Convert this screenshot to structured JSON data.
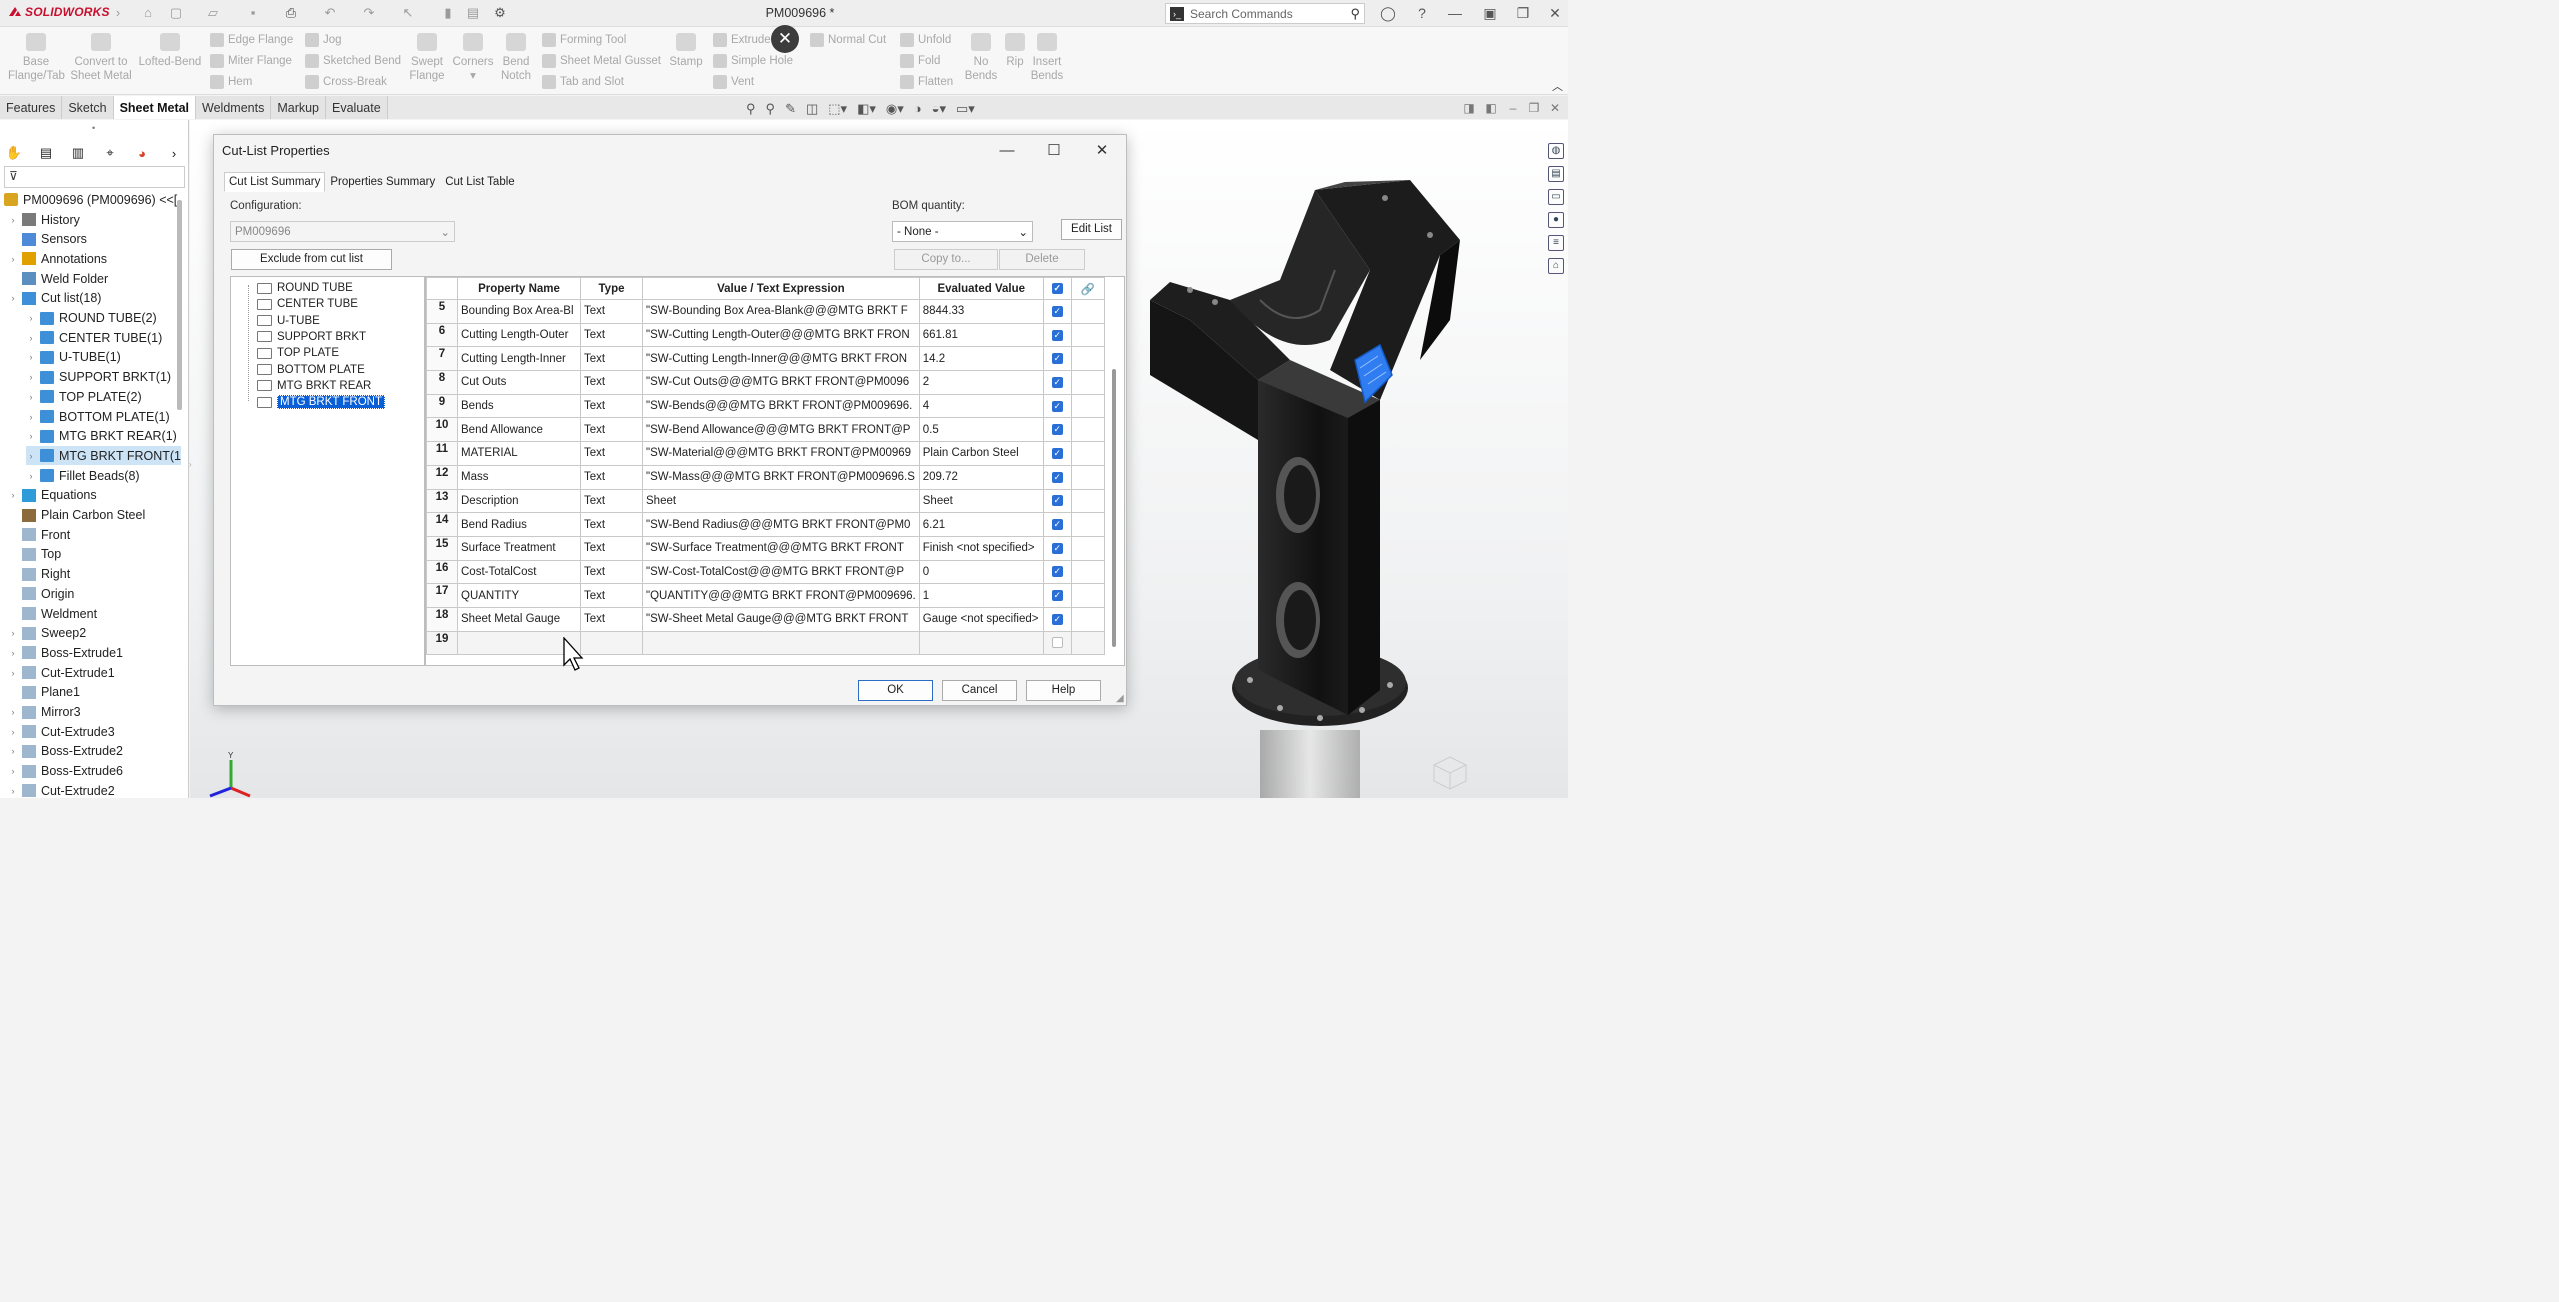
{
  "app": {
    "logo": "SOLIDWORKS",
    "doc_title": "PM009696 *",
    "search_placeholder": "Search Commands"
  },
  "commands": {
    "base_flange": [
      "Base",
      "Flange/Tab"
    ],
    "convert": [
      "Convert to",
      "Sheet Metal"
    ],
    "lofted_bend": "Lofted-Bend",
    "edge_flange": "Edge Flange",
    "jog": "Jog",
    "miter_flange": "Miter Flange",
    "sketched_bend": "Sketched Bend",
    "hem": "Hem",
    "cross_break": "Cross-Break",
    "swept_flange": [
      "Swept",
      "Flange"
    ],
    "corners": "Corners",
    "bend_notch": [
      "Bend",
      "Notch"
    ],
    "forming_tool": "Forming Tool",
    "sheet_metal_gusset": "Sheet Metal Gusset",
    "tab_and_slot": "Tab and Slot",
    "stamp": "Stamp",
    "extruded_cut": "Extrude",
    "simple_hole": "Simple Hole",
    "vent": "Vent",
    "normal_cut": "Normal Cut",
    "unfold": "Unfold",
    "fold": "Fold",
    "flatten": "Flatten",
    "no_bends": [
      "No",
      "Bends"
    ],
    "rip": "Rip",
    "insert_bends": [
      "Insert",
      "Bends"
    ]
  },
  "tabs": [
    "Features",
    "Sketch",
    "Sheet Metal",
    "Weldments",
    "Markup",
    "Evaluate"
  ],
  "active_tab": "Sheet Metal",
  "tree": {
    "root": "PM009696 (PM009696) <<[",
    "items": [
      {
        "label": "History",
        "indent": 0,
        "twisty": true
      },
      {
        "label": "Sensors",
        "indent": 0,
        "twisty": false
      },
      {
        "label": "Annotations",
        "indent": 0,
        "twisty": true
      },
      {
        "label": "Weld Folder",
        "indent": 0,
        "twisty": false
      },
      {
        "label": "Cut list(18)",
        "indent": 0,
        "twisty": true
      },
      {
        "label": "ROUND TUBE(2)",
        "indent": 1,
        "twisty": true
      },
      {
        "label": "CENTER TUBE(1)",
        "indent": 1,
        "twisty": true
      },
      {
        "label": "U-TUBE(1)",
        "indent": 1,
        "twisty": true
      },
      {
        "label": "SUPPORT BRKT(1)",
        "indent": 1,
        "twisty": true
      },
      {
        "label": "TOP PLATE(2)",
        "indent": 1,
        "twisty": true
      },
      {
        "label": "BOTTOM PLATE(1)",
        "indent": 1,
        "twisty": true
      },
      {
        "label": "MTG BRKT REAR(1)",
        "indent": 1,
        "twisty": true
      },
      {
        "label": "MTG BRKT FRONT(1",
        "indent": 1,
        "twisty": true,
        "selected": true
      },
      {
        "label": "Fillet Beads(8)",
        "indent": 1,
        "twisty": true
      },
      {
        "label": "Equations",
        "indent": 0,
        "twisty": true
      },
      {
        "label": "Plain Carbon Steel",
        "indent": 0,
        "twisty": false
      },
      {
        "label": "Front",
        "indent": 0,
        "twisty": false
      },
      {
        "label": "Top",
        "indent": 0,
        "twisty": false
      },
      {
        "label": "Right",
        "indent": 0,
        "twisty": false
      },
      {
        "label": "Origin",
        "indent": 0,
        "twisty": false
      },
      {
        "label": "Weldment",
        "indent": 0,
        "twisty": false
      },
      {
        "label": "Sweep2",
        "indent": 0,
        "twisty": true
      },
      {
        "label": "Boss-Extrude1",
        "indent": 0,
        "twisty": true
      },
      {
        "label": "Cut-Extrude1",
        "indent": 0,
        "twisty": true
      },
      {
        "label": "Plane1",
        "indent": 0,
        "twisty": false
      },
      {
        "label": "Mirror3",
        "indent": 0,
        "twisty": true
      },
      {
        "label": "Cut-Extrude3",
        "indent": 0,
        "twisty": true
      },
      {
        "label": "Boss-Extrude2",
        "indent": 0,
        "twisty": true
      },
      {
        "label": "Boss-Extrude6",
        "indent": 0,
        "twisty": true
      },
      {
        "label": "Cut-Extrude2",
        "indent": 0,
        "twisty": true
      }
    ]
  },
  "dialog": {
    "title": "Cut-List Properties",
    "tabs": [
      "Cut List Summary",
      "Properties Summary",
      "Cut List Table"
    ],
    "configuration_label": "Configuration:",
    "configuration_value": "PM009696",
    "bom_label": "BOM quantity:",
    "bom_value": "- None -",
    "edit_list": "Edit List",
    "exclude": "Exclude from cut list",
    "copy_to": "Copy to...",
    "delete": "Delete",
    "cutlist_items": [
      "ROUND TUBE",
      "CENTER TUBE",
      "U-TUBE",
      "SUPPORT BRKT",
      "TOP PLATE",
      "BOTTOM PLATE",
      "MTG BRKT REAR",
      "MTG BRKT FRONT"
    ],
    "selected_item": "MTG BRKT FRONT",
    "columns": [
      "Property Name",
      "Type",
      "Value / Text Expression",
      "Evaluated Value"
    ],
    "rows": [
      {
        "n": "5",
        "name": "Bounding Box Area-Bl",
        "type": "Text",
        "expr": "\"SW-Bounding Box Area-Blank@@@MTG BRKT F",
        "val": "8844.33",
        "checked": true
      },
      {
        "n": "6",
        "name": "Cutting Length-Outer",
        "type": "Text",
        "expr": "\"SW-Cutting Length-Outer@@@MTG BRKT FRON",
        "val": "661.81",
        "checked": true
      },
      {
        "n": "7",
        "name": "Cutting Length-Inner",
        "type": "Text",
        "expr": "\"SW-Cutting Length-Inner@@@MTG BRKT FRON",
        "val": "14.2",
        "checked": true
      },
      {
        "n": "8",
        "name": "Cut Outs",
        "type": "Text",
        "expr": "\"SW-Cut Outs@@@MTG BRKT FRONT@PM0096",
        "val": "2",
        "checked": true
      },
      {
        "n": "9",
        "name": "Bends",
        "type": "Text",
        "expr": "\"SW-Bends@@@MTG BRKT FRONT@PM009696.",
        "val": "4",
        "checked": true
      },
      {
        "n": "10",
        "name": "Bend Allowance",
        "type": "Text",
        "expr": "\"SW-Bend Allowance@@@MTG BRKT FRONT@P",
        "val": "0.5",
        "checked": true
      },
      {
        "n": "11",
        "name": "MATERIAL",
        "type": "Text",
        "expr": "\"SW-Material@@@MTG BRKT FRONT@PM00969",
        "val": "Plain Carbon Steel",
        "checked": true
      },
      {
        "n": "12",
        "name": "Mass",
        "type": "Text",
        "expr": "\"SW-Mass@@@MTG BRKT FRONT@PM009696.S",
        "val": "209.72",
        "checked": true
      },
      {
        "n": "13",
        "name": "Description",
        "type": "Text",
        "expr": "Sheet",
        "val": "Sheet",
        "checked": true
      },
      {
        "n": "14",
        "name": "Bend Radius",
        "type": "Text",
        "expr": "\"SW-Bend Radius@@@MTG BRKT FRONT@PM0",
        "val": "6.21",
        "checked": true
      },
      {
        "n": "15",
        "name": "Surface Treatment",
        "type": "Text",
        "expr": "\"SW-Surface Treatment@@@MTG BRKT FRONT",
        "val": "Finish <not specified>",
        "checked": true
      },
      {
        "n": "16",
        "name": "Cost-TotalCost",
        "type": "Text",
        "expr": "\"SW-Cost-TotalCost@@@MTG BRKT FRONT@P",
        "val": "0",
        "checked": true
      },
      {
        "n": "17",
        "name": "QUANTITY",
        "type": "Text",
        "expr": "\"QUANTITY@@@MTG BRKT FRONT@PM009696.",
        "val": "1",
        "checked": true
      },
      {
        "n": "18",
        "name": "Sheet Metal Gauge",
        "type": "Text",
        "expr": "\"SW-Sheet Metal Gauge@@@MTG BRKT FRONT",
        "val": "Gauge <not specified>",
        "checked": true
      },
      {
        "n": "19",
        "name": "",
        "type": "",
        "expr": "",
        "val": "",
        "checked": false
      }
    ],
    "ok": "OK",
    "cancel": "Cancel",
    "help": "Help"
  },
  "colors": {
    "accent": "#2a6fd6",
    "selection": "#0a5fd6",
    "part_black": "#1c1c1c",
    "sketch_blue": "#2f7df0",
    "logo_red": "#c8102e"
  },
  "icons": [
    "home-icon",
    "new-doc-icon",
    "open-icon",
    "save-icon",
    "print-icon",
    "undo-icon",
    "redo-icon",
    "select-icon",
    "rebuild-icon",
    "options-icon",
    "search-icon",
    "user-icon",
    "help-icon",
    "minimize-icon",
    "maximize-icon",
    "close-icon"
  ]
}
